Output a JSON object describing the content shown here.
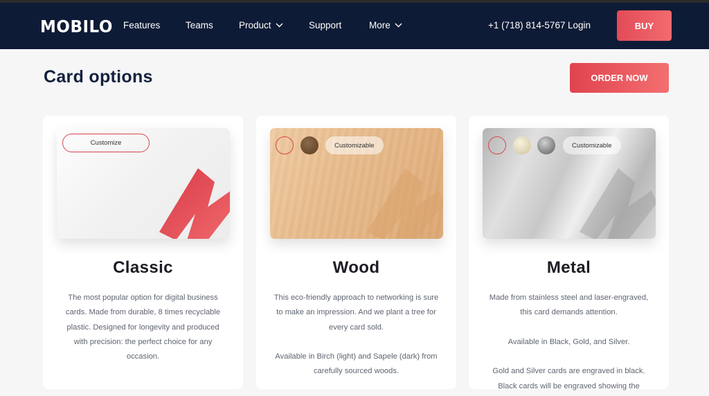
{
  "nav": {
    "logo": "MOBILO",
    "items": [
      {
        "label": "Features",
        "has_dropdown": false
      },
      {
        "label": "Teams",
        "has_dropdown": false
      },
      {
        "label": "Product",
        "has_dropdown": true
      },
      {
        "label": "Support",
        "has_dropdown": false
      },
      {
        "label": "More",
        "has_dropdown": true
      }
    ],
    "phone": "+1 (718) 814-5767",
    "login": "Login",
    "buy": "BUY"
  },
  "header": {
    "title": "Card options",
    "order_button": "ORDER NOW"
  },
  "cards": [
    {
      "title": "Classic",
      "pill": "Customize",
      "description": [
        "The most popular option for digital business cards. Made from durable, 8 times recyclable plastic. Designed for longevity and produced with precision: the perfect choice for any occasion."
      ]
    },
    {
      "title": "Wood",
      "pill": "Customizable",
      "swatches": [
        "birch",
        "sapele"
      ],
      "description": [
        "This eco-friendly approach to networking is sure to make an impression. And we plant a tree for every card sold.",
        "Available in Birch (light) and Sapele (dark) from carefully sourced  woods."
      ]
    },
    {
      "title": "Metal",
      "pill": "Customizable",
      "swatches": [
        "black",
        "gold",
        "silver"
      ],
      "description": [
        "Made from stainless steel and laser-engraved, this card demands attention.",
        "Available in Black, Gold, and Silver.",
        "Gold and Silver cards are engraved in black. Black cards will be engraved showing the"
      ]
    }
  ],
  "colors": {
    "nav_bg": "#0e1b36",
    "accent": "#e24b57",
    "title": "#14213d",
    "text": "#5e6470"
  },
  "icons": {
    "dropdown": "chevron-down-icon",
    "brand_mark": "mobilo-m-logo"
  }
}
